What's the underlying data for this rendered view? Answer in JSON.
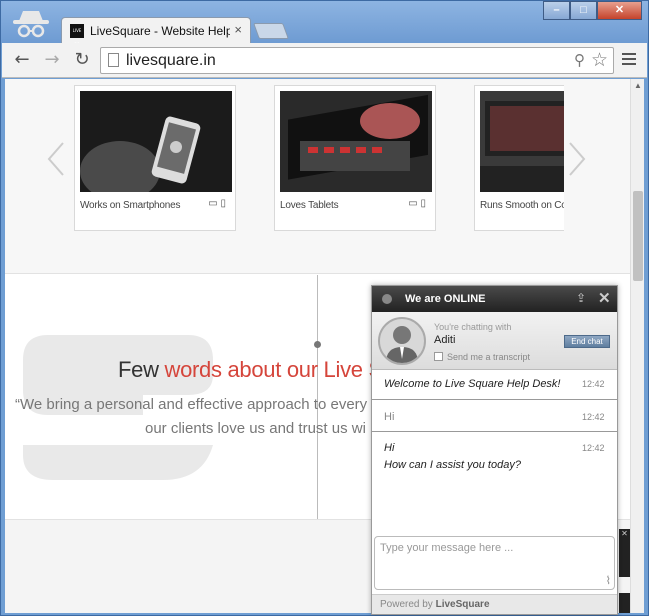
{
  "browser": {
    "tab_title": "LiveSquare - Website HelpDesk",
    "tab_close": "×",
    "tab_favicon_text": "LIVE SQ",
    "url": "livesquare.in",
    "win_minimize": "–",
    "win_maximize": "□",
    "win_close": "✕"
  },
  "nav": {
    "back": "←",
    "forward": "→",
    "reload": "↻"
  },
  "slider": {
    "cards": [
      {
        "caption": "Works on Smartphones"
      },
      {
        "caption": "Loves Tablets"
      },
      {
        "caption": "Runs Smooth on Computers"
      }
    ]
  },
  "testimonials": {
    "heading_plain": "Few ",
    "heading_accent": "words about our Live Su",
    "quote_line1": "“We bring a personal and effective approach to every",
    "quote_line2": "our clients love us and trust us wi"
  },
  "chat": {
    "title": "We are ONLINE",
    "chatting_with": "You're chatting with",
    "agent_name": "Aditi",
    "send_transcript": "Send me a transcript",
    "end_chat": "End chat",
    "messages": [
      {
        "text": "Welcome to Live Square Help Desk!",
        "time": "12:42"
      },
      {
        "text": "Hi",
        "time": "12:42"
      },
      {
        "text": "Hi",
        "text2": "How can I assist you today?",
        "time": "12:42"
      }
    ],
    "input_placeholder": "Type your message here ...",
    "powered_by": "Powered by",
    "powered_brand": "LiveSquare"
  },
  "colors": {
    "accent": "#d5453b",
    "chrome_frame": "#6f9ed3"
  }
}
